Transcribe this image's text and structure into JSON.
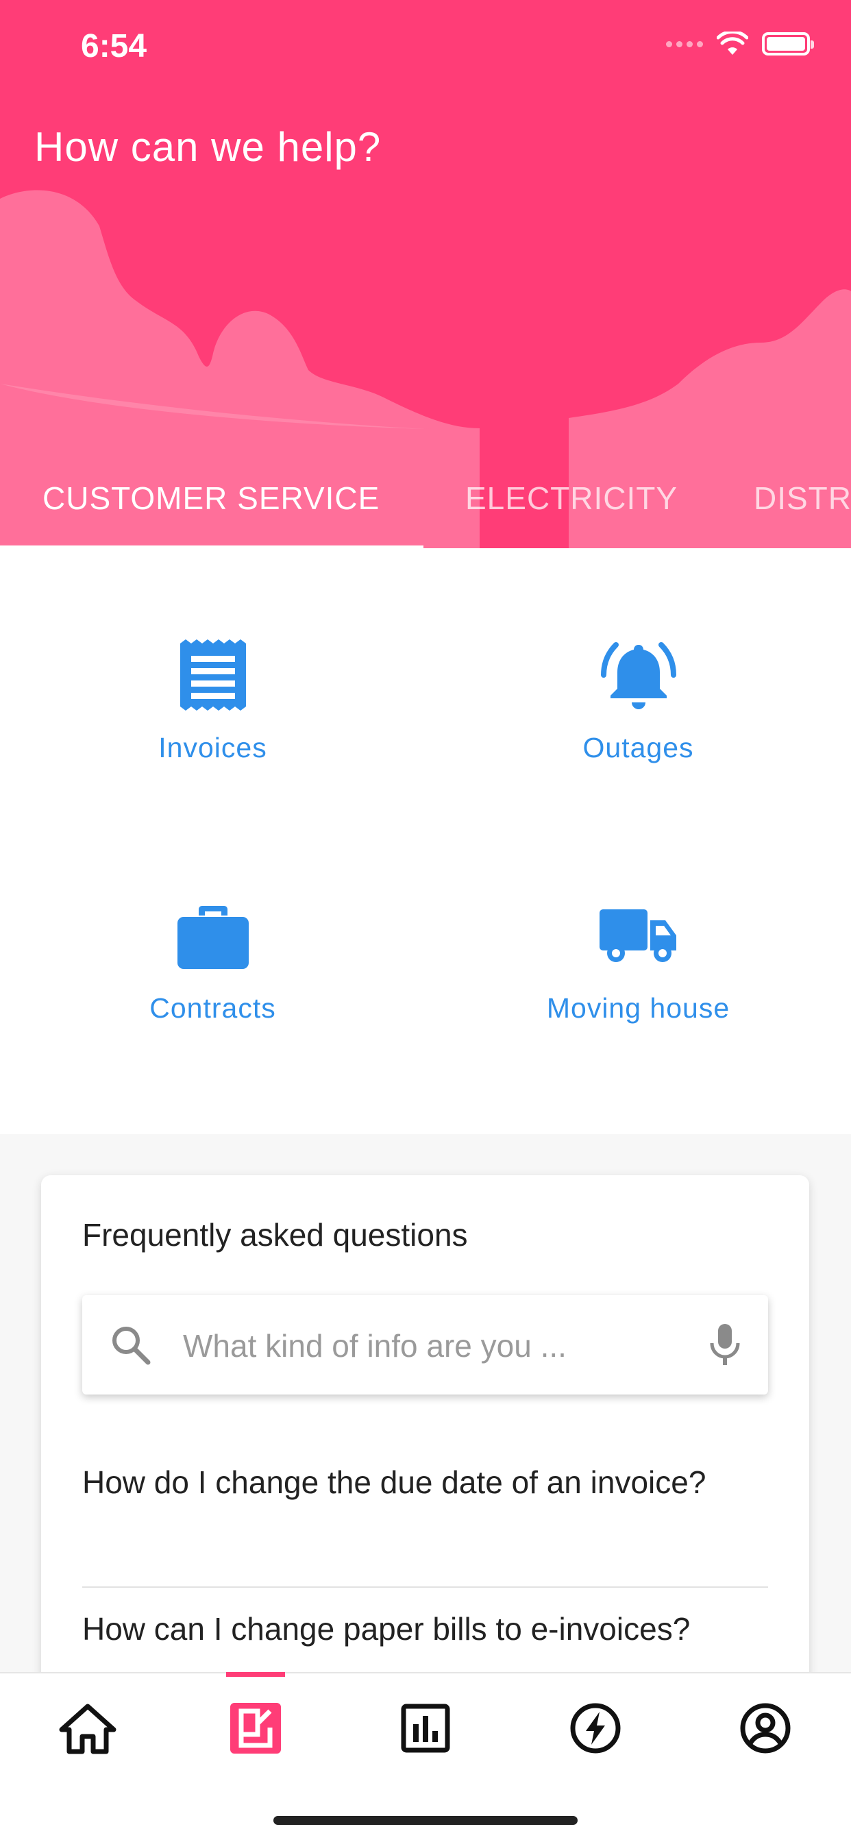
{
  "status_bar": {
    "time": "6:54"
  },
  "header": {
    "title": "How can we help?"
  },
  "tabs": [
    {
      "label": "CUSTOMER SERVICE",
      "active": true
    },
    {
      "label": "ELECTRICITY",
      "active": false
    },
    {
      "label": "DISTR",
      "active": false
    }
  ],
  "tiles": [
    {
      "label": "Invoices",
      "icon": "receipt-icon"
    },
    {
      "label": "Outages",
      "icon": "bell-ringing-icon"
    },
    {
      "label": "Contracts",
      "icon": "briefcase-icon"
    },
    {
      "label": "Moving house",
      "icon": "truck-icon"
    }
  ],
  "faq": {
    "title": "Frequently asked questions",
    "search_placeholder": "What kind of info are you ...",
    "items": [
      "How do I change the due date of an invoice?",
      "How can I change paper bills to e-invoices?"
    ]
  },
  "bottom_nav": {
    "items": [
      "home-icon",
      "service-icon",
      "stats-icon",
      "energy-icon",
      "account-icon"
    ],
    "active": "service-icon"
  },
  "colors": {
    "brand_pink": "#ff3d77",
    "icon_blue": "#2f8fea"
  }
}
